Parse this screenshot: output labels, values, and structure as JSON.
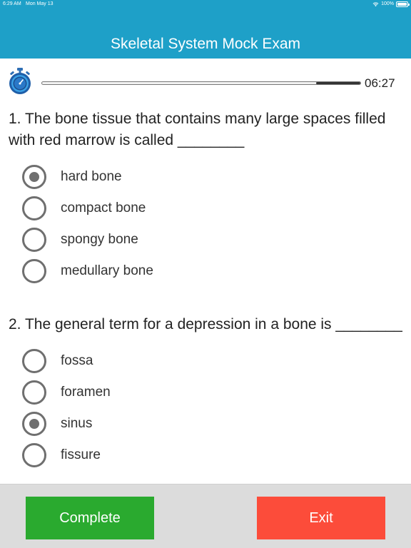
{
  "status_bar": {
    "time": "6:29 AM",
    "date": "Mon May 13",
    "battery": "100%"
  },
  "header": {
    "title": "Skeletal System Mock Exam"
  },
  "timer": {
    "remaining": "06:27",
    "progress": 0.14
  },
  "questions": [
    {
      "text": "1. The bone tissue that contains many large spaces filled with red marrow is called ________",
      "options": [
        {
          "label": "hard bone",
          "selected": true
        },
        {
          "label": "compact bone",
          "selected": false
        },
        {
          "label": "spongy bone",
          "selected": false
        },
        {
          "label": "medullary bone",
          "selected": false
        }
      ]
    },
    {
      "text": "2. The general term for a depression in a bone is ________",
      "options": [
        {
          "label": "fossa",
          "selected": false
        },
        {
          "label": "foramen",
          "selected": false
        },
        {
          "label": "sinus",
          "selected": true
        },
        {
          "label": "fissure",
          "selected": false
        }
      ]
    }
  ],
  "footer": {
    "complete_label": "Complete",
    "exit_label": "Exit"
  },
  "colors": {
    "header": "#1ea0c8",
    "complete": "#2aaa2f",
    "exit": "#fc4c3a",
    "radio": "#6f6f6f"
  }
}
